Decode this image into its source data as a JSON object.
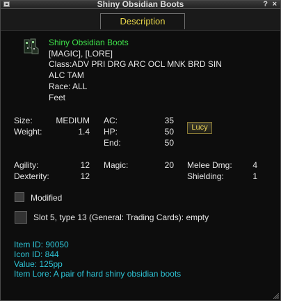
{
  "window": {
    "title": "Shiny Obsidian Boots",
    "help_glyph": "?",
    "close_glyph": "×"
  },
  "tab": {
    "label": "Description"
  },
  "item": {
    "name": "Shiny Obsidian Boots",
    "flags": "[MAGIC], [LORE]",
    "class_line1": "Class:ADV PRI DRG ARC OCL MNK BRD SIN",
    "class_line2": "ALC TAM",
    "race": "Race:  ALL",
    "slot": "Feet",
    "icon": "boots-icon"
  },
  "stats": {
    "size_label": "Size:",
    "size_value": "MEDIUM",
    "weight_label": "Weight:",
    "weight_value": "1.4",
    "ac_label": "AC:",
    "ac_value": "35",
    "hp_label": "HP:",
    "hp_value": "50",
    "end_label": "End:",
    "end_value": "50",
    "agility_label": "Agility:",
    "agility_value": "12",
    "dexterity_label": "Dexterity:",
    "dexterity_value": "12",
    "magic_label": "Magic:",
    "magic_value": "20",
    "melee_label": "Melee Dmg:",
    "melee_value": "4",
    "shielding_label": "Shielding:",
    "shielding_value": "1"
  },
  "lucy_button": {
    "label": "Lucy"
  },
  "modified": {
    "label": "Modified"
  },
  "aug_slot": {
    "label": "Slot 5, type 13 (General: Trading Cards): empty"
  },
  "footer": {
    "item_id": "Item ID: 90050",
    "icon_id": "Icon ID: 844",
    "value": "Value: 125pp",
    "lore": "Item Lore: A pair of hard shiny obsidian boots"
  },
  "colors": {
    "name_green": "#3ee04a",
    "info_cyan": "#2ec4d6",
    "tab_yellow": "#e8d64a"
  }
}
